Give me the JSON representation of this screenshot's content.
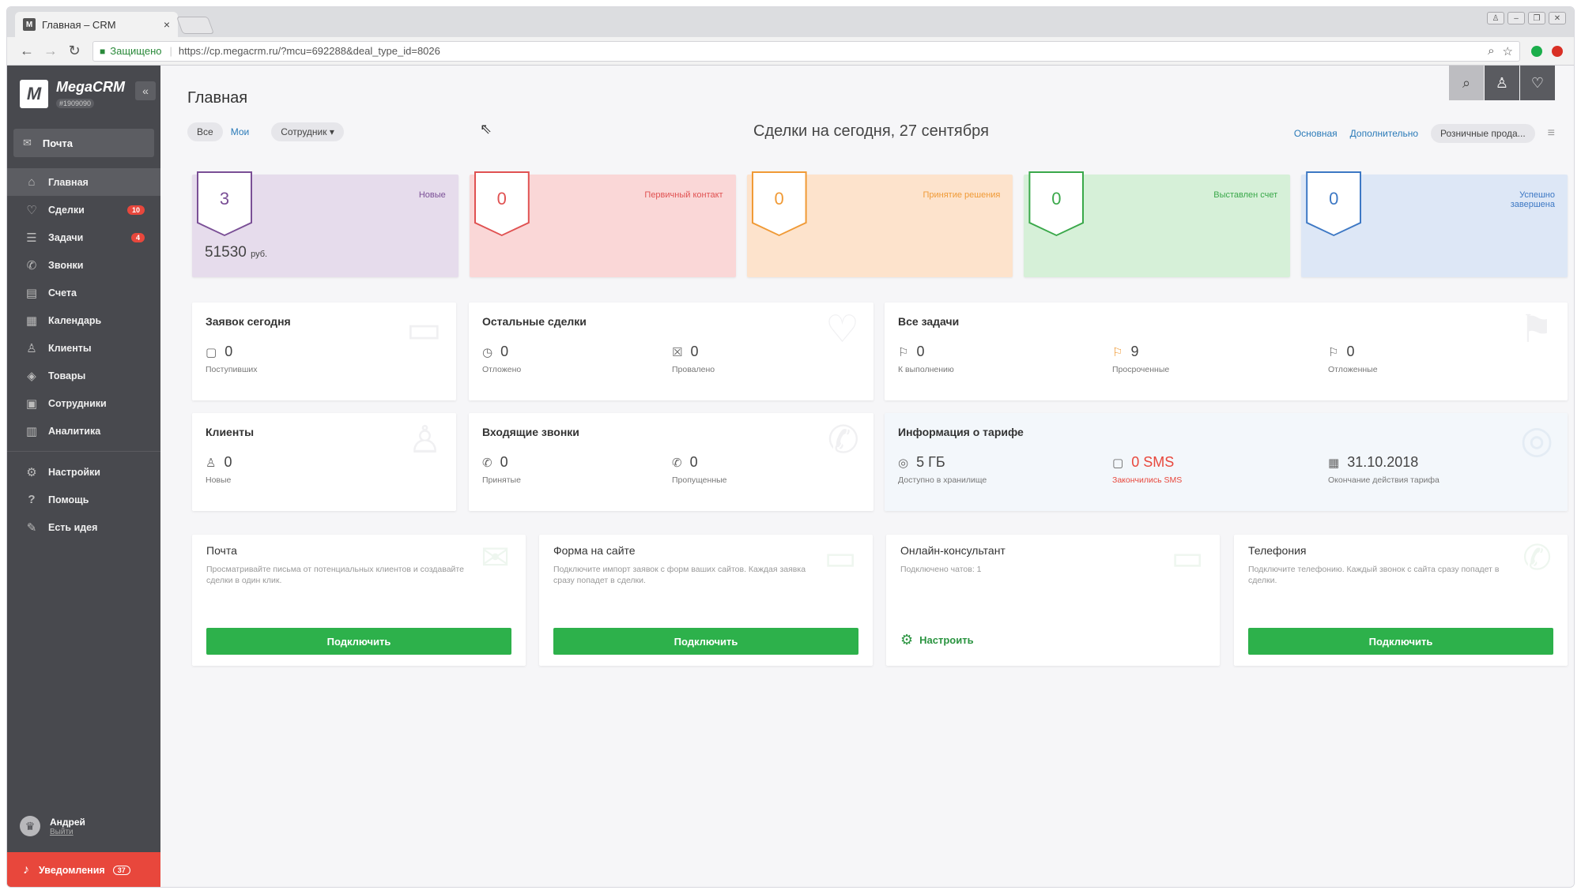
{
  "browser": {
    "tab_title": "Главная – CRM",
    "tab_favicon": "M",
    "tab_close": "×",
    "secure_label": "Защищено",
    "url": "https://cp.megacrm.ru/?mcu=692288&deal_type_id=8026"
  },
  "sidebar": {
    "brand_name": "MegaCRM",
    "brand_id": "#1909090",
    "mail_label": "Почта",
    "items": [
      {
        "label": "Главная",
        "icon": "home-icon",
        "glyph": "⌂"
      },
      {
        "label": "Сделки",
        "icon": "handshake-icon",
        "glyph": "♡",
        "badge": "10"
      },
      {
        "label": "Задачи",
        "icon": "clipboard-icon",
        "glyph": "☰",
        "badge": "4"
      },
      {
        "label": "Звонки",
        "icon": "phone-icon",
        "glyph": "✆"
      },
      {
        "label": "Счета",
        "icon": "invoice-icon",
        "glyph": "▤"
      },
      {
        "label": "Календарь",
        "icon": "calendar-icon",
        "glyph": "▦"
      },
      {
        "label": "Клиенты",
        "icon": "user-icon",
        "glyph": "♙"
      },
      {
        "label": "Товары",
        "icon": "box-icon",
        "glyph": "◈"
      },
      {
        "label": "Сотрудники",
        "icon": "team-icon",
        "glyph": "▣"
      },
      {
        "label": "Аналитика",
        "icon": "chart-icon",
        "glyph": "▥"
      },
      {
        "label": "Настройки",
        "icon": "gear-icon",
        "glyph": "⚙"
      },
      {
        "label": "Помощь",
        "icon": "help-icon",
        "glyph": "?"
      },
      {
        "label": "Есть идея",
        "icon": "idea-icon",
        "glyph": "✎"
      }
    ],
    "user_name": "Андрей",
    "logout": "Выйти",
    "notifications_label": "Уведомления",
    "notifications_count": "37"
  },
  "header": {
    "title": "Главная",
    "filter_all": "Все",
    "filter_mine": "Мои",
    "filter_employee": "Сотрудник ▾",
    "deals_title": "Сделки на сегодня, 27 сентября",
    "view_main": "Основная",
    "view_extra": "Дополнительно",
    "view_retail": "Розничные прода..."
  },
  "stages": [
    {
      "label": "Новые",
      "count": "3",
      "sum": "51530",
      "currency": "руб.",
      "bg": "#e6dcec",
      "color": "#7a4f96"
    },
    {
      "label": "Первичный контакт",
      "count": "0",
      "bg": "#fad7d7",
      "color": "#e05252"
    },
    {
      "label": "Принятие решения",
      "count": "0",
      "bg": "#fde3cc",
      "color": "#f09a36"
    },
    {
      "label": "Выставлен счет",
      "count": "0",
      "bg": "#d6f0d8",
      "color": "#3aa84a"
    },
    {
      "label": "Успешно завершена",
      "count": "0",
      "bg": "#dde7f6",
      "color": "#3d78c4"
    }
  ],
  "cards": {
    "requests": {
      "title": "Заявок сегодня",
      "value": "0",
      "sub": "Поступивших"
    },
    "other_deals": {
      "title": "Остальные сделки",
      "postponed": "0",
      "postponed_label": "Отложено",
      "failed": "0",
      "failed_label": "Провалено"
    },
    "tasks": {
      "title": "Все задачи",
      "todo": "0",
      "todo_label": "К выполнению",
      "overdue": "9",
      "overdue_label": "Просроченные",
      "postponed": "0",
      "postponed_label": "Отложенные"
    },
    "clients": {
      "title": "Клиенты",
      "value": "0",
      "sub": "Новые"
    },
    "calls": {
      "title": "Входящие звонки",
      "accepted": "0",
      "accepted_label": "Принятые",
      "missed": "0",
      "missed_label": "Пропущенные"
    },
    "tariff": {
      "title": "Информация о тарифе",
      "storage": "5 ГБ",
      "storage_label": "Доступно в хранилище",
      "sms": "0 SMS",
      "sms_label": "Закончились SMS",
      "date": "31.10.2018",
      "date_label": "Окончание действия тарифа"
    }
  },
  "integrations": [
    {
      "title": "Почта",
      "desc": "Просматривайте письма от потенциальных клиентов и создавайте сделки в один клик.",
      "button": "Подключить",
      "icon": "envelope-icon"
    },
    {
      "title": "Форма на сайте",
      "desc": "Подключите импорт заявок с форм ваших сайтов. Каждая заявка сразу попадет в сделки.",
      "button": "Подключить",
      "icon": "form-icon"
    },
    {
      "title": "Онлайн-консультант",
      "desc": "Подключено чатов: 1",
      "button": "Настроить",
      "icon": "chat-icon"
    },
    {
      "title": "Телефония",
      "desc": "Подключите телефонию. Каждый звонок с сайта сразу попадет в сделки.",
      "button": "Подключить",
      "icon": "phone-icon"
    }
  ]
}
